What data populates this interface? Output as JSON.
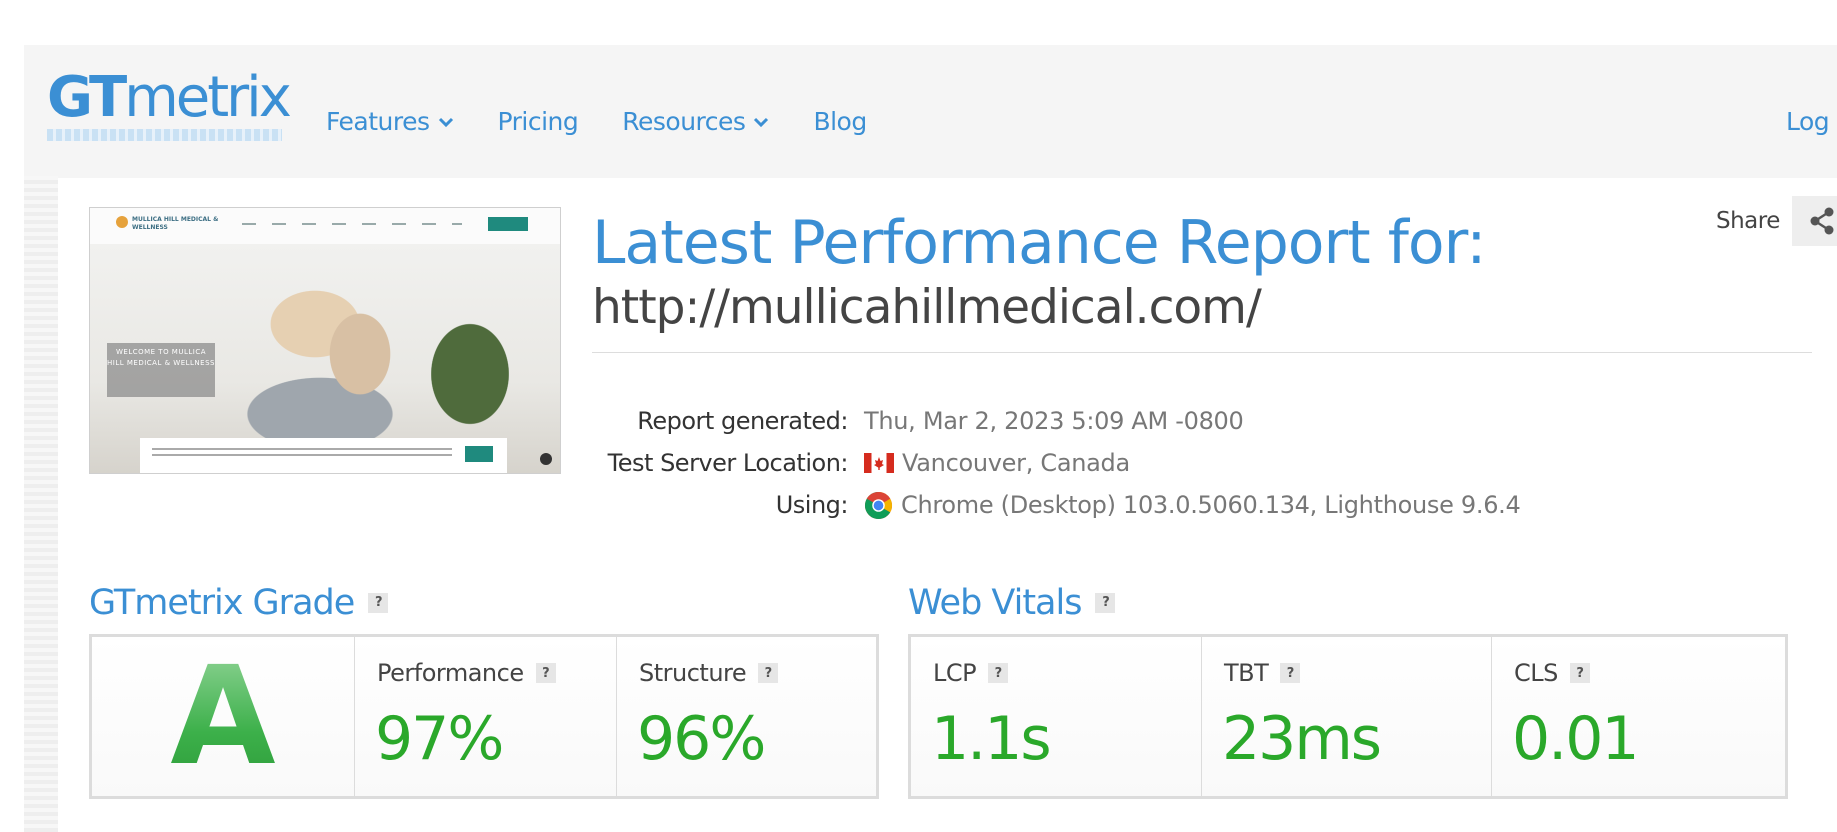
{
  "header": {
    "logo": {
      "part1": "GT",
      "part2": "metrix"
    },
    "nav": [
      {
        "label": "Features",
        "dropdown": true
      },
      {
        "label": "Pricing",
        "dropdown": false
      },
      {
        "label": "Resources",
        "dropdown": true
      },
      {
        "label": "Blog",
        "dropdown": false
      }
    ],
    "login_label": "Log"
  },
  "report": {
    "title": "Latest Performance Report for:",
    "url": "http://mullicahillmedical.com/",
    "share_label": "Share",
    "meta": [
      {
        "label": "Report generated:",
        "value": "Thu, Mar 2, 2023 5:09 AM -0800",
        "icon": ""
      },
      {
        "label": "Test Server Location:",
        "value": "Vancouver, Canada",
        "icon": "canada-flag-icon"
      },
      {
        "label": "Using:",
        "value": "Chrome (Desktop) 103.0.5060.134, Lighthouse 9.6.4",
        "icon": "chrome-icon"
      }
    ],
    "thumbnail": {
      "site_logo": "MULLICA HILL MEDICAL & WELLNESS",
      "welcome_text": "WELCOME TO MULLICA HILL MEDICAL & WELLNESS"
    }
  },
  "grade": {
    "title": "GTmetrix Grade",
    "help": "?",
    "letter": "A",
    "performance": {
      "label": "Performance",
      "value": "97%"
    },
    "structure": {
      "label": "Structure",
      "value": "96%"
    }
  },
  "vitals": {
    "title": "Web Vitals",
    "help": "?",
    "items": [
      {
        "label": "LCP",
        "value": "1.1s"
      },
      {
        "label": "TBT",
        "value": "23ms"
      },
      {
        "label": "CLS",
        "value": "0.01"
      }
    ]
  },
  "colors": {
    "brand_blue": "#3b8fd4",
    "good_green": "#2aa82a"
  }
}
